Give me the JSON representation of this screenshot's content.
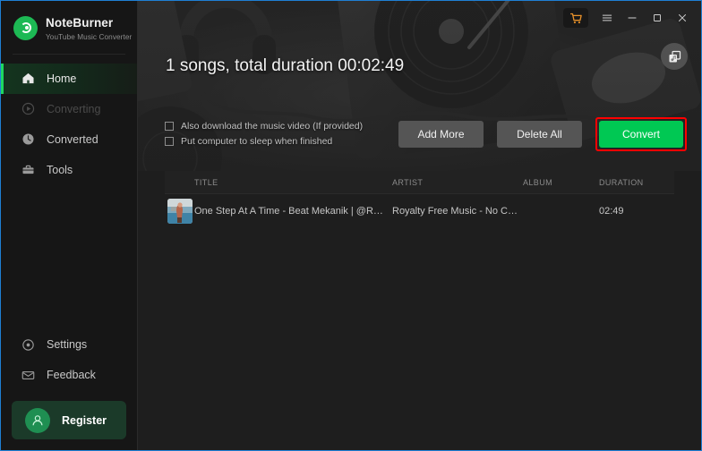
{
  "app": {
    "brand_name": "NoteBurner",
    "brand_subtitle": "YouTube Music Converter",
    "accent_green": "#1ed760",
    "convert_green": "#00c853",
    "highlight_red": "#ff0000",
    "cart_orange": "#e8912a"
  },
  "titlebar": {
    "cart_icon": "shopping-cart-icon",
    "menu_icon": "hamburger-menu-icon",
    "minimize_icon": "minimize-icon",
    "maximize_icon": "maximize-icon",
    "close_icon": "close-icon",
    "library_icon": "music-library-icon"
  },
  "sidebar": {
    "items": [
      {
        "label": "Home",
        "icon": "home-icon",
        "state": "active"
      },
      {
        "label": "Converting",
        "icon": "converting-icon",
        "state": "disabled"
      },
      {
        "label": "Converted",
        "icon": "clock-icon",
        "state": "normal"
      },
      {
        "label": "Tools",
        "icon": "toolbox-icon",
        "state": "normal"
      }
    ],
    "bottom_items": [
      {
        "label": "Settings",
        "icon": "gear-icon"
      },
      {
        "label": "Feedback",
        "icon": "envelope-icon"
      }
    ],
    "register": {
      "label": "Register",
      "icon": "user-avatar-icon"
    }
  },
  "banner": {
    "summary": "1 songs, total duration 00:02:49",
    "options": [
      {
        "label": "Also download the music video (If provided)",
        "checked": false
      },
      {
        "label": "Put computer to sleep when finished",
        "checked": false
      }
    ],
    "buttons": {
      "add_more": "Add More",
      "delete_all": "Delete All",
      "convert": "Convert"
    }
  },
  "table": {
    "columns": {
      "title": "TITLE",
      "artist": "ARTIST",
      "album": "ALBUM",
      "duration": "DURATION"
    },
    "rows": [
      {
        "thumbnail": "song-thumbnail",
        "title": "One Step At A Time - Beat Mekanik | @RF...",
        "artist": "Royalty Free Music - No Copy...",
        "album": "",
        "duration": "02:49"
      }
    ]
  }
}
